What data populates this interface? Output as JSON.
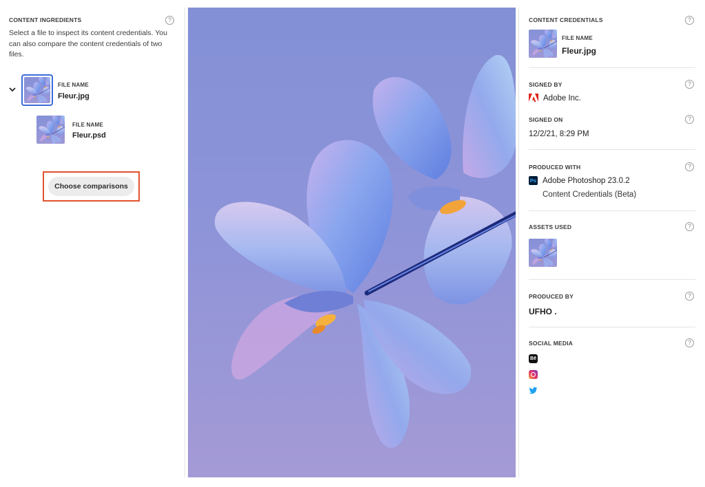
{
  "left": {
    "header": "CONTENT INGREDIENTS",
    "help": "?",
    "description": "Select a file to inspect its content credentials. You can also compare the content credentials of two files.",
    "files": [
      {
        "label": "FILE NAME",
        "name": "Fleur.jpg"
      },
      {
        "label": "FILE NAME",
        "name": "Fleur.psd"
      }
    ],
    "choose_button": "Choose comparisons",
    "accent_color": "#e0522f"
  },
  "right": {
    "header": "CONTENT CREDENTIALS",
    "file": {
      "label": "FILE NAME",
      "name": "Fleur.jpg"
    },
    "signed_by": {
      "title": "SIGNED BY",
      "value": "Adobe Inc."
    },
    "signed_on": {
      "title": "SIGNED ON",
      "value": "12/2/21, 8:29 PM"
    },
    "produced_with": {
      "title": "PRODUCED WITH",
      "app": "Adobe Photoshop 23.0.2",
      "detail": "Content Credentials (Beta)",
      "app_icon": "Ps"
    },
    "assets_used": {
      "title": "ASSETS USED"
    },
    "produced_by": {
      "title": "PRODUCED BY",
      "value": "UFHO ."
    },
    "social_media": {
      "title": "SOCIAL MEDIA",
      "icons": [
        "behance-icon",
        "instagram-icon",
        "twitter-icon"
      ],
      "behance_text": "Bē"
    },
    "help": "?"
  }
}
